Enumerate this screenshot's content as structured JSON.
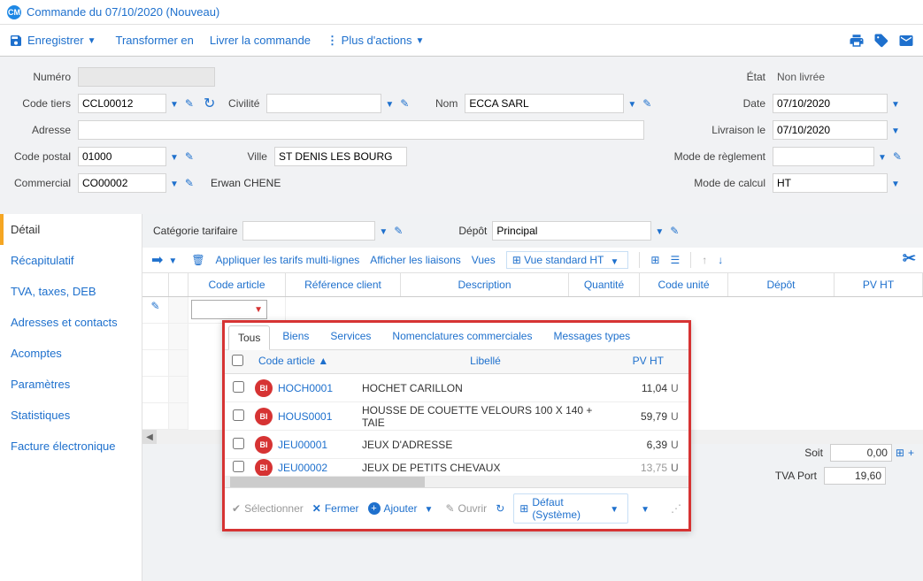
{
  "window": {
    "title": "Commande du 07/10/2020 (Nouveau)",
    "badge": "CM"
  },
  "toolbar": {
    "save": "Enregistrer",
    "transform": "Transformer en",
    "deliver": "Livrer la commande",
    "more": "Plus d'actions"
  },
  "header": {
    "left": {
      "numero_label": "Numéro",
      "numero_value": "",
      "code_tiers_label": "Code tiers",
      "code_tiers_value": "CCL00012",
      "civilite_label": "Civilité",
      "civilite_value": "",
      "nom_label": "Nom",
      "nom_value": "ECCA SARL",
      "adresse_label": "Adresse",
      "adresse_value": "",
      "cp_label": "Code postal",
      "cp_value": "01000",
      "ville_label": "Ville",
      "ville_value": "ST DENIS LES BOURG",
      "commercial_label": "Commercial",
      "commercial_value": "CO00002",
      "commercial_name": "Erwan CHENE"
    },
    "right": {
      "etat_label": "État",
      "etat_value": "Non livrée",
      "date_label": "Date",
      "date_value": "07/10/2020",
      "livraison_label": "Livraison le",
      "livraison_value": "07/10/2020",
      "reglement_label": "Mode de règlement",
      "reglement_value": "",
      "calcul_label": "Mode de calcul",
      "calcul_value": "HT"
    }
  },
  "sidebar": {
    "items": [
      "Détail",
      "Récapitulatif",
      "TVA, taxes, DEB",
      "Adresses et contacts",
      "Acomptes",
      "Paramètres",
      "Statistiques",
      "Facture électronique"
    ]
  },
  "content": {
    "cat_label": "Catégorie tarifaire",
    "cat_value": "",
    "depot_label": "Dépôt",
    "depot_value": "Principal",
    "grid_tb": {
      "apply": "Appliquer les tarifs multi-lignes",
      "links": "Afficher les liaisons",
      "views_label": "Vues",
      "view_name": "Vue standard HT"
    },
    "columns": {
      "code": "Code article",
      "ref": "Référence client",
      "desc": "Description",
      "qte": "Quantité",
      "unite": "Code unité",
      "depot": "Dépôt",
      "pvht": "PV HT"
    }
  },
  "popup": {
    "tabs": [
      "Tous",
      "Biens",
      "Services",
      "Nomenclatures commerciales",
      "Messages types"
    ],
    "cols": {
      "code": "Code article",
      "lib": "Libellé",
      "pv": "PV HT"
    },
    "rows": [
      {
        "code": "HOCH0001",
        "lib": "HOCHET CARILLON",
        "pv": "11,04",
        "u": "U"
      },
      {
        "code": "HOUS0001",
        "lib": "HOUSSE DE COUETTE VELOURS 100 X 140 + TAIE",
        "pv": "59,79",
        "u": "U"
      },
      {
        "code": "JEU00001",
        "lib": "JEUX D'ADRESSE",
        "pv": "6,39",
        "u": "U"
      },
      {
        "code": "JEU00002",
        "lib": "JEUX DE PETITS CHEVAUX",
        "pv": "13,75",
        "u": "U"
      }
    ],
    "footer": {
      "select": "Sélectionner",
      "close": "Fermer",
      "add": "Ajouter",
      "open": "Ouvrir",
      "default": "Défaut (Système)"
    }
  },
  "totals": {
    "soit_label": "Soit",
    "soit_value": "0,00",
    "tva_label": "TVA Port",
    "tva_value": "19,60"
  }
}
